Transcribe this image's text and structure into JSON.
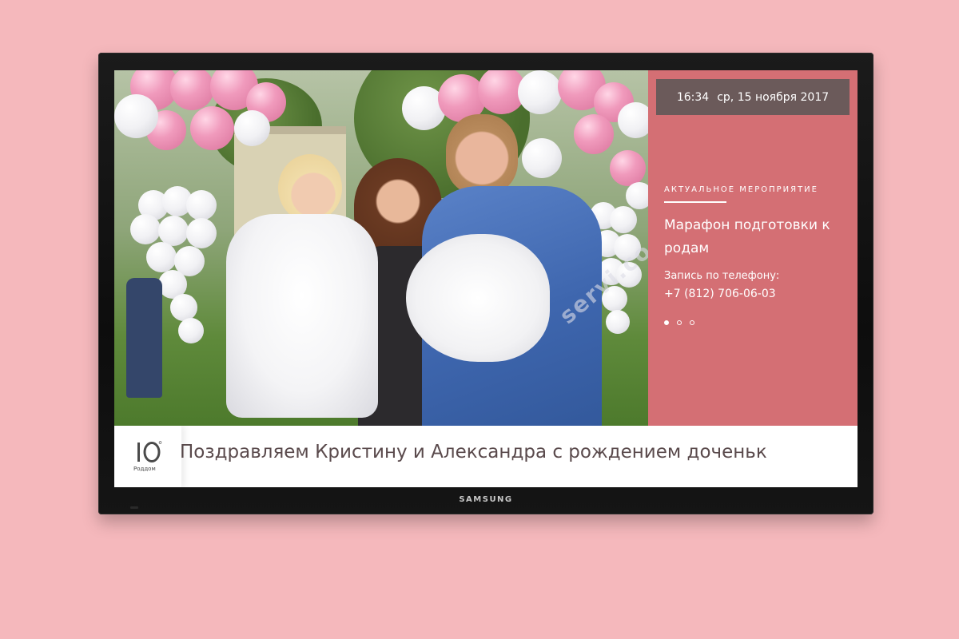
{
  "tv": {
    "brand": "SAMSUNG"
  },
  "panel": {
    "time": "16:34",
    "date": "ср, 15 ноября 2017",
    "kicker": "Актуальное мероприятие",
    "title": "Марафон подготовки к родам",
    "phone_label": "Запись по телефону:",
    "phone": "+7 (812) 706-06-03",
    "slides": [
      {
        "active": true
      },
      {
        "active": false
      },
      {
        "active": false
      }
    ],
    "accent_color": "#d46f74",
    "clock_bg": "#6b5a5a"
  },
  "ticker": {
    "logo_mark": "10",
    "logo_text": "Роддом",
    "message": "Поздравляем Кристину и Александра с рождением доченьк"
  },
  "photo": {
    "description_icon": "family-photo"
  }
}
